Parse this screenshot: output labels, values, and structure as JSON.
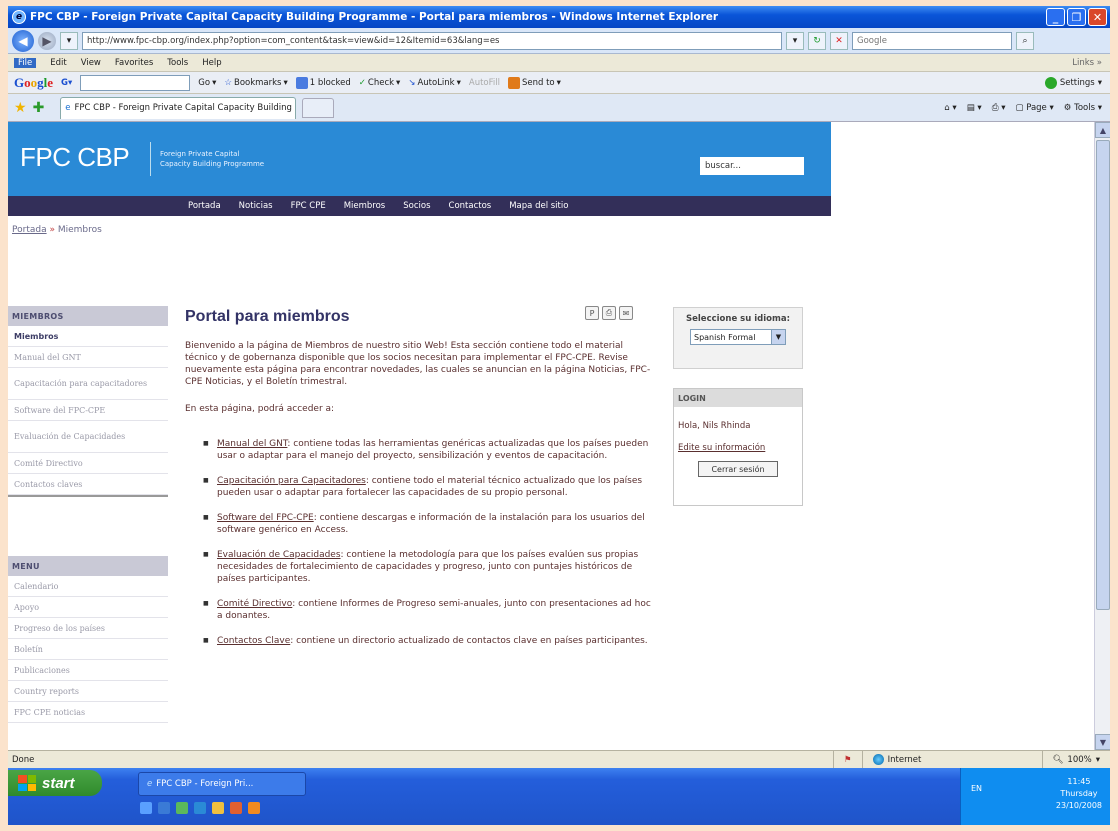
{
  "window": {
    "title": "FPC CBP - Foreign Private Capital Capacity Building Programme - Portal para miembros - Windows Internet Explorer",
    "controls": [
      "_",
      "❐",
      "✕"
    ]
  },
  "addressbar": {
    "url": "http://www.fpc-cbp.org/index.php?option=com_content&task=view&id=12&Itemid=63&lang=es",
    "search_placeholder": "Google"
  },
  "menubar": [
    "File",
    "Edit",
    "View",
    "Favorites",
    "Tools",
    "Help"
  ],
  "menubar_links": "Links »",
  "google_toolbar": {
    "logo": [
      "G",
      "o",
      "o",
      "g",
      "l",
      "e"
    ],
    "go": "Go",
    "bookmarks": "Bookmarks",
    "blocked": "1 blocked",
    "check": "Check",
    "autolink": "AutoLink",
    "autofill": "AutoFill",
    "sendto": "Send to",
    "settings": "Settings"
  },
  "tabbar": {
    "tab_title": "FPC CBP - Foreign Private Capital Capacity Building Pr...",
    "page": "Page",
    "tools": "Tools"
  },
  "site": {
    "logo": "FPC CBP",
    "logo_sub_1": "Foreign Private Capital",
    "logo_sub_2": "Capacity Building Programme",
    "search_value": "buscar...",
    "nav": [
      "Portada",
      "Noticias",
      "FPC CPE",
      "Miembros",
      "Socios",
      "Contactos",
      "Mapa del sitio"
    ],
    "breadcrumb_home": "Portada",
    "breadcrumb_sep": "»",
    "breadcrumb_current": "Miembros"
  },
  "sidebar": {
    "miembros_header": "MIEMBROS",
    "miembros_items": [
      "Miembros",
      "Manual del GNT",
      "Capacitación para capacitadores",
      "Software del FPC-CPE",
      "Evaluación de Capacidades",
      "Comité Directivo",
      "Contactos claves"
    ],
    "menu_header": "MENU",
    "menu_items": [
      "Calendario",
      "Apoyo",
      "Progreso de los países",
      "Boletín",
      "Publicaciones",
      "Country reports",
      "FPC CPE noticias"
    ]
  },
  "main": {
    "title": "Portal para miembros",
    "intro": "Bienvenido a la página de Miembros de nuestro sitio Web! Esta sección contiene todo el material técnico y de gobernanza disponible que los socios necesitan para implementar el FPC-CPE. Revise nuevamente esta página para encontrar novedades, las cuales se anuncian en la página Noticias, FPC-CPE Noticias, y el Boletín trimestral.",
    "intro_2": "En esta página, podrá acceder a:",
    "bullets": [
      {
        "link": "Manual del GNT",
        "text": ": contiene todas las herramientas genéricas actualizadas que los países pueden usar o adaptar para el manejo del proyecto, sensibilización y eventos de capacitación."
      },
      {
        "link": "Capacitación para Capacitadores",
        "text": ": contiene todo el material técnico actualizado que los países pueden usar o adaptar para fortalecer las capacidades de su propio personal."
      },
      {
        "link": "Software del FPC-CPE",
        "text": ": contiene descargas e información de la instalación para los usuarios del software genérico en Access."
      },
      {
        "link": "Evaluación de Capacidades",
        "text": ": contiene la metodología para que los países evalúen sus propias necesidades de fortalecimiento de capacidades y progreso, junto con puntajes históricos de países participantes."
      },
      {
        "link": "Comité Directivo",
        "text": ": contiene Informes de Progreso semi-anuales, junto con presentaciones ad hoc a donantes."
      },
      {
        "link": "Contactos Clave",
        "text": ": contiene un directorio actualizado de contactos clave en países participantes."
      }
    ]
  },
  "language_box": {
    "label": "Seleccione su idioma:",
    "selected": "Spanish Formal"
  },
  "login_box": {
    "header": "LOGIN",
    "greeting": "Hola, Nils Rhinda",
    "edit_link": "Edite su información",
    "logout": "Cerrar sesión"
  },
  "statusbar": {
    "text": "Done",
    "zone": "Internet",
    "zoom": "100%"
  },
  "taskbar": {
    "start": "start",
    "task_item": "FPC CBP - Foreign Pri...",
    "lang": "EN",
    "time": "11:45",
    "day": "Thursday",
    "date": "23/10/2008"
  }
}
